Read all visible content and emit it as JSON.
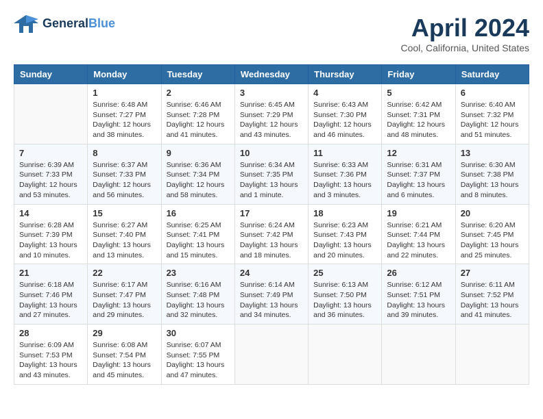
{
  "header": {
    "logo_line1": "General",
    "logo_line2": "Blue",
    "month": "April 2024",
    "location": "Cool, California, United States"
  },
  "days_of_week": [
    "Sunday",
    "Monday",
    "Tuesday",
    "Wednesday",
    "Thursday",
    "Friday",
    "Saturday"
  ],
  "weeks": [
    [
      {
        "num": "",
        "empty": true
      },
      {
        "num": "1",
        "sunrise": "6:48 AM",
        "sunset": "7:27 PM",
        "daylight": "12 hours and 38 minutes."
      },
      {
        "num": "2",
        "sunrise": "6:46 AM",
        "sunset": "7:28 PM",
        "daylight": "12 hours and 41 minutes."
      },
      {
        "num": "3",
        "sunrise": "6:45 AM",
        "sunset": "7:29 PM",
        "daylight": "12 hours and 43 minutes."
      },
      {
        "num": "4",
        "sunrise": "6:43 AM",
        "sunset": "7:30 PM",
        "daylight": "12 hours and 46 minutes."
      },
      {
        "num": "5",
        "sunrise": "6:42 AM",
        "sunset": "7:31 PM",
        "daylight": "12 hours and 48 minutes."
      },
      {
        "num": "6",
        "sunrise": "6:40 AM",
        "sunset": "7:32 PM",
        "daylight": "12 hours and 51 minutes."
      }
    ],
    [
      {
        "num": "7",
        "sunrise": "6:39 AM",
        "sunset": "7:33 PM",
        "daylight": "12 hours and 53 minutes."
      },
      {
        "num": "8",
        "sunrise": "6:37 AM",
        "sunset": "7:33 PM",
        "daylight": "12 hours and 56 minutes."
      },
      {
        "num": "9",
        "sunrise": "6:36 AM",
        "sunset": "7:34 PM",
        "daylight": "12 hours and 58 minutes."
      },
      {
        "num": "10",
        "sunrise": "6:34 AM",
        "sunset": "7:35 PM",
        "daylight": "13 hours and 1 minute."
      },
      {
        "num": "11",
        "sunrise": "6:33 AM",
        "sunset": "7:36 PM",
        "daylight": "13 hours and 3 minutes."
      },
      {
        "num": "12",
        "sunrise": "6:31 AM",
        "sunset": "7:37 PM",
        "daylight": "13 hours and 6 minutes."
      },
      {
        "num": "13",
        "sunrise": "6:30 AM",
        "sunset": "7:38 PM",
        "daylight": "13 hours and 8 minutes."
      }
    ],
    [
      {
        "num": "14",
        "sunrise": "6:28 AM",
        "sunset": "7:39 PM",
        "daylight": "13 hours and 10 minutes."
      },
      {
        "num": "15",
        "sunrise": "6:27 AM",
        "sunset": "7:40 PM",
        "daylight": "13 hours and 13 minutes."
      },
      {
        "num": "16",
        "sunrise": "6:25 AM",
        "sunset": "7:41 PM",
        "daylight": "13 hours and 15 minutes."
      },
      {
        "num": "17",
        "sunrise": "6:24 AM",
        "sunset": "7:42 PM",
        "daylight": "13 hours and 18 minutes."
      },
      {
        "num": "18",
        "sunrise": "6:23 AM",
        "sunset": "7:43 PM",
        "daylight": "13 hours and 20 minutes."
      },
      {
        "num": "19",
        "sunrise": "6:21 AM",
        "sunset": "7:44 PM",
        "daylight": "13 hours and 22 minutes."
      },
      {
        "num": "20",
        "sunrise": "6:20 AM",
        "sunset": "7:45 PM",
        "daylight": "13 hours and 25 minutes."
      }
    ],
    [
      {
        "num": "21",
        "sunrise": "6:18 AM",
        "sunset": "7:46 PM",
        "daylight": "13 hours and 27 minutes."
      },
      {
        "num": "22",
        "sunrise": "6:17 AM",
        "sunset": "7:47 PM",
        "daylight": "13 hours and 29 minutes."
      },
      {
        "num": "23",
        "sunrise": "6:16 AM",
        "sunset": "7:48 PM",
        "daylight": "13 hours and 32 minutes."
      },
      {
        "num": "24",
        "sunrise": "6:14 AM",
        "sunset": "7:49 PM",
        "daylight": "13 hours and 34 minutes."
      },
      {
        "num": "25",
        "sunrise": "6:13 AM",
        "sunset": "7:50 PM",
        "daylight": "13 hours and 36 minutes."
      },
      {
        "num": "26",
        "sunrise": "6:12 AM",
        "sunset": "7:51 PM",
        "daylight": "13 hours and 39 minutes."
      },
      {
        "num": "27",
        "sunrise": "6:11 AM",
        "sunset": "7:52 PM",
        "daylight": "13 hours and 41 minutes."
      }
    ],
    [
      {
        "num": "28",
        "sunrise": "6:09 AM",
        "sunset": "7:53 PM",
        "daylight": "13 hours and 43 minutes."
      },
      {
        "num": "29",
        "sunrise": "6:08 AM",
        "sunset": "7:54 PM",
        "daylight": "13 hours and 45 minutes."
      },
      {
        "num": "30",
        "sunrise": "6:07 AM",
        "sunset": "7:55 PM",
        "daylight": "13 hours and 47 minutes."
      },
      {
        "num": "",
        "empty": true
      },
      {
        "num": "",
        "empty": true
      },
      {
        "num": "",
        "empty": true
      },
      {
        "num": "",
        "empty": true
      }
    ]
  ]
}
